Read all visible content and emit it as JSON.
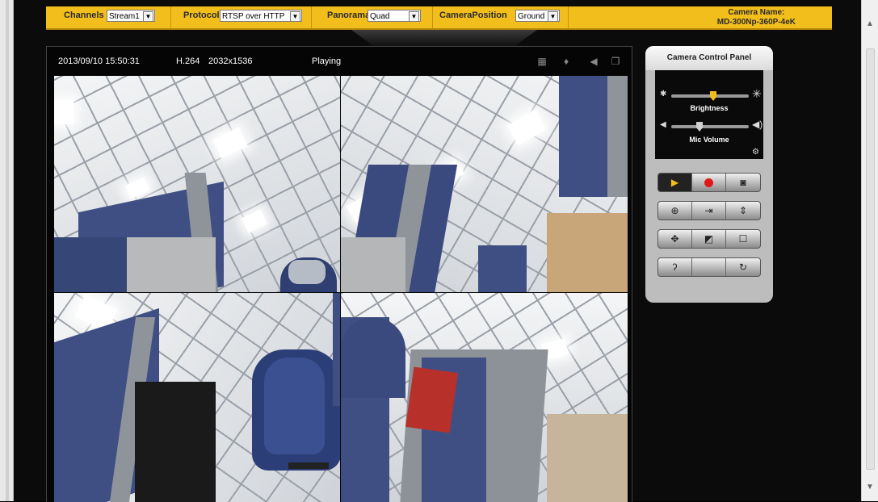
{
  "toolbar": {
    "channel_label": "Channels",
    "channel_value": "Stream1",
    "protocol_label": "Protocol",
    "protocol_value": "RTSP over HTTP",
    "panorama_label": "Panorama",
    "panorama_value": "Quad",
    "position_label": "CameraPosition",
    "position_value": "Ground",
    "camera_name_label": "Camera Name:",
    "camera_name_value": "MD-300Np-360P-4eK"
  },
  "viewer": {
    "timestamp": "2013/09/10 15:50:31",
    "codec": "H.264",
    "resolution": "2032x1536",
    "status": "Playing",
    "icons": [
      "network-icon",
      "microphone-icon",
      "speaker-icon",
      "fullscreen-icon"
    ]
  },
  "control_panel": {
    "title": "Camera Control Panel",
    "brightness_label": "Brightness",
    "brightness_level": 0.55,
    "mic_label": "Mic Volume",
    "mic_level": 0.35,
    "buttons": [
      [
        "play-icon",
        "record-icon",
        "snapshot-icon"
      ],
      [
        "zoom-in-icon",
        "fit-width-icon",
        "fit-height-icon"
      ],
      [
        "pan-icon",
        "window-icon",
        "frame-icon"
      ],
      [
        "listen-icon",
        "blank",
        "rotate-icon"
      ]
    ]
  },
  "colors": {
    "toolbar": "#f2be1c",
    "record": "#e01818",
    "play": "#f2be1c",
    "panel": "#bdbdbd"
  }
}
